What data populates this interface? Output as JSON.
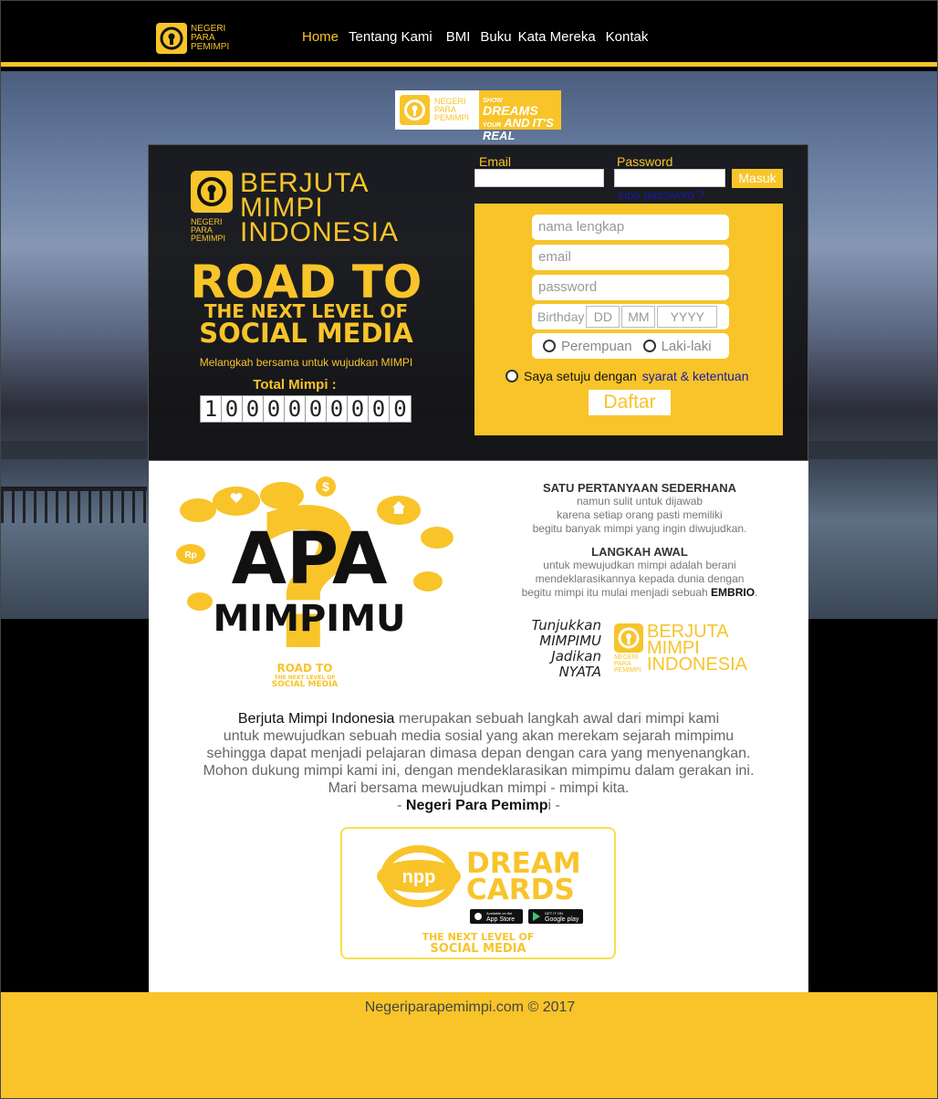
{
  "nav": {
    "logo_text": [
      "NEGERI",
      "PARA",
      "PEMIMPI"
    ],
    "items": [
      {
        "label": "Home",
        "active": true
      },
      {
        "label": "Tentang Kami"
      },
      {
        "label": "BMI"
      },
      {
        "label": "Buku"
      },
      {
        "label": "Kata Mereka"
      },
      {
        "label": "Kontak"
      }
    ]
  },
  "badge": {
    "left_text": [
      "NEGERI",
      "PARA",
      "PEMIMPI"
    ],
    "right_text": [
      "SHOW",
      "YOUR",
      "DREAMS",
      "AND",
      "IT'S",
      "REAL"
    ]
  },
  "hero": {
    "brand_small": [
      "NEGERI",
      "PARA",
      "PEMIMPI"
    ],
    "brand_big": [
      "BERJUTA",
      "MIMPI",
      "INDONESIA"
    ],
    "headline_1": "ROAD TO",
    "headline_2": "THE NEXT LEVEL OF",
    "headline_3": "SOCIAL MEDIA",
    "tagline": "Melangkah bersama untuk wujudkan MIMPI",
    "total_label": "Total Mimpi :",
    "total_digits": [
      "1",
      "0",
      "0",
      "0",
      "0",
      "0",
      "0",
      "0",
      "0",
      "0"
    ]
  },
  "login": {
    "email_label": "Email",
    "password_label": "Password",
    "submit_label": "Masuk",
    "forgot_label": "lupa password ?"
  },
  "register": {
    "fullname_placeholder": "nama lengkap",
    "email_placeholder": "email",
    "password_placeholder": "password",
    "birthday_label": "Birthday",
    "birthday_dd": "DD",
    "birthday_mm": "MM",
    "birthday_yyyy": "YYYY",
    "gender_female": "Perempuan",
    "gender_male": "Laki-laki",
    "agree_text": "Saya setuju dengan",
    "agree_link": "syarat & ketentuan",
    "submit_label": "Daftar"
  },
  "content": {
    "graphic": {
      "apa": "APA",
      "mimpimu": "MIMPIMU",
      "road_1": "ROAD TO",
      "road_2": "THE NEXT LEVEL OF",
      "road_3": "SOCIAL MEDIA",
      "rp": "Rp",
      "dollar": "$"
    },
    "q1_title": "SATU PERTANYAAN SEDERHANA",
    "q1_lines": [
      "namun sulit untuk dijawab",
      "karena setiap orang pasti memiliki",
      "begitu banyak mimpi yang ingin diwujudkan."
    ],
    "q2_title": "LANGKAH AWAL",
    "q2_lines": [
      "untuk mewujudkan mimpi adalah berani",
      "mendeklarasikannya kepada dunia dengan"
    ],
    "q2_last_prefix": "begitu mimpi itu mulai menjadi sebuah",
    "q2_last_bold": "EMBRIO",
    "q2_last_suffix": ".",
    "tunjukkan": [
      "Tunjukkan",
      "MIMPIMU",
      "Jadikan",
      "NYATA"
    ],
    "bmi_small": [
      "NEGERI",
      "PARA",
      "PEMIMPI"
    ],
    "bmi_big": [
      "BERJUTA",
      "MIMPI",
      "INDONESIA"
    ],
    "para_highlight": "Berjuta Mimpi Indonesia",
    "para_first_rest": " merupakan sebuah langkah awal dari mimpi kami",
    "para_lines": [
      "untuk mewujudkan sebuah media sosial yang akan merekam sejarah mimpimu",
      "sehingga dapat menjadi pelajaran dimasa depan dengan cara yang menyenangkan.",
      "Mohon dukung mimpi kami ini, dengan mendeklarasikan mimpimu dalam gerakan ini.",
      "Mari bersama mewujudkan mimpi - mimpi kita."
    ],
    "signoff_prefix": "- ",
    "signoff_bold": "Negeri Para Pemimp",
    "signoff_suffix": "i -",
    "dream": {
      "npp": "npp",
      "dream": "DREAM",
      "cards": "CARDS",
      "appstore_small": "Available on the",
      "appstore": "App Store",
      "gplay_small": "GET IT ON",
      "gplay": "Google play",
      "road_1": "THE NEXT LEVEL OF",
      "road_2": "SOCIAL MEDIA"
    }
  },
  "footer": {
    "text": "Negeriparapemimpi.com © 2017"
  },
  "colors": {
    "accent": "#f8c42a",
    "link": "#1a1aa0",
    "dark": "#000000"
  }
}
